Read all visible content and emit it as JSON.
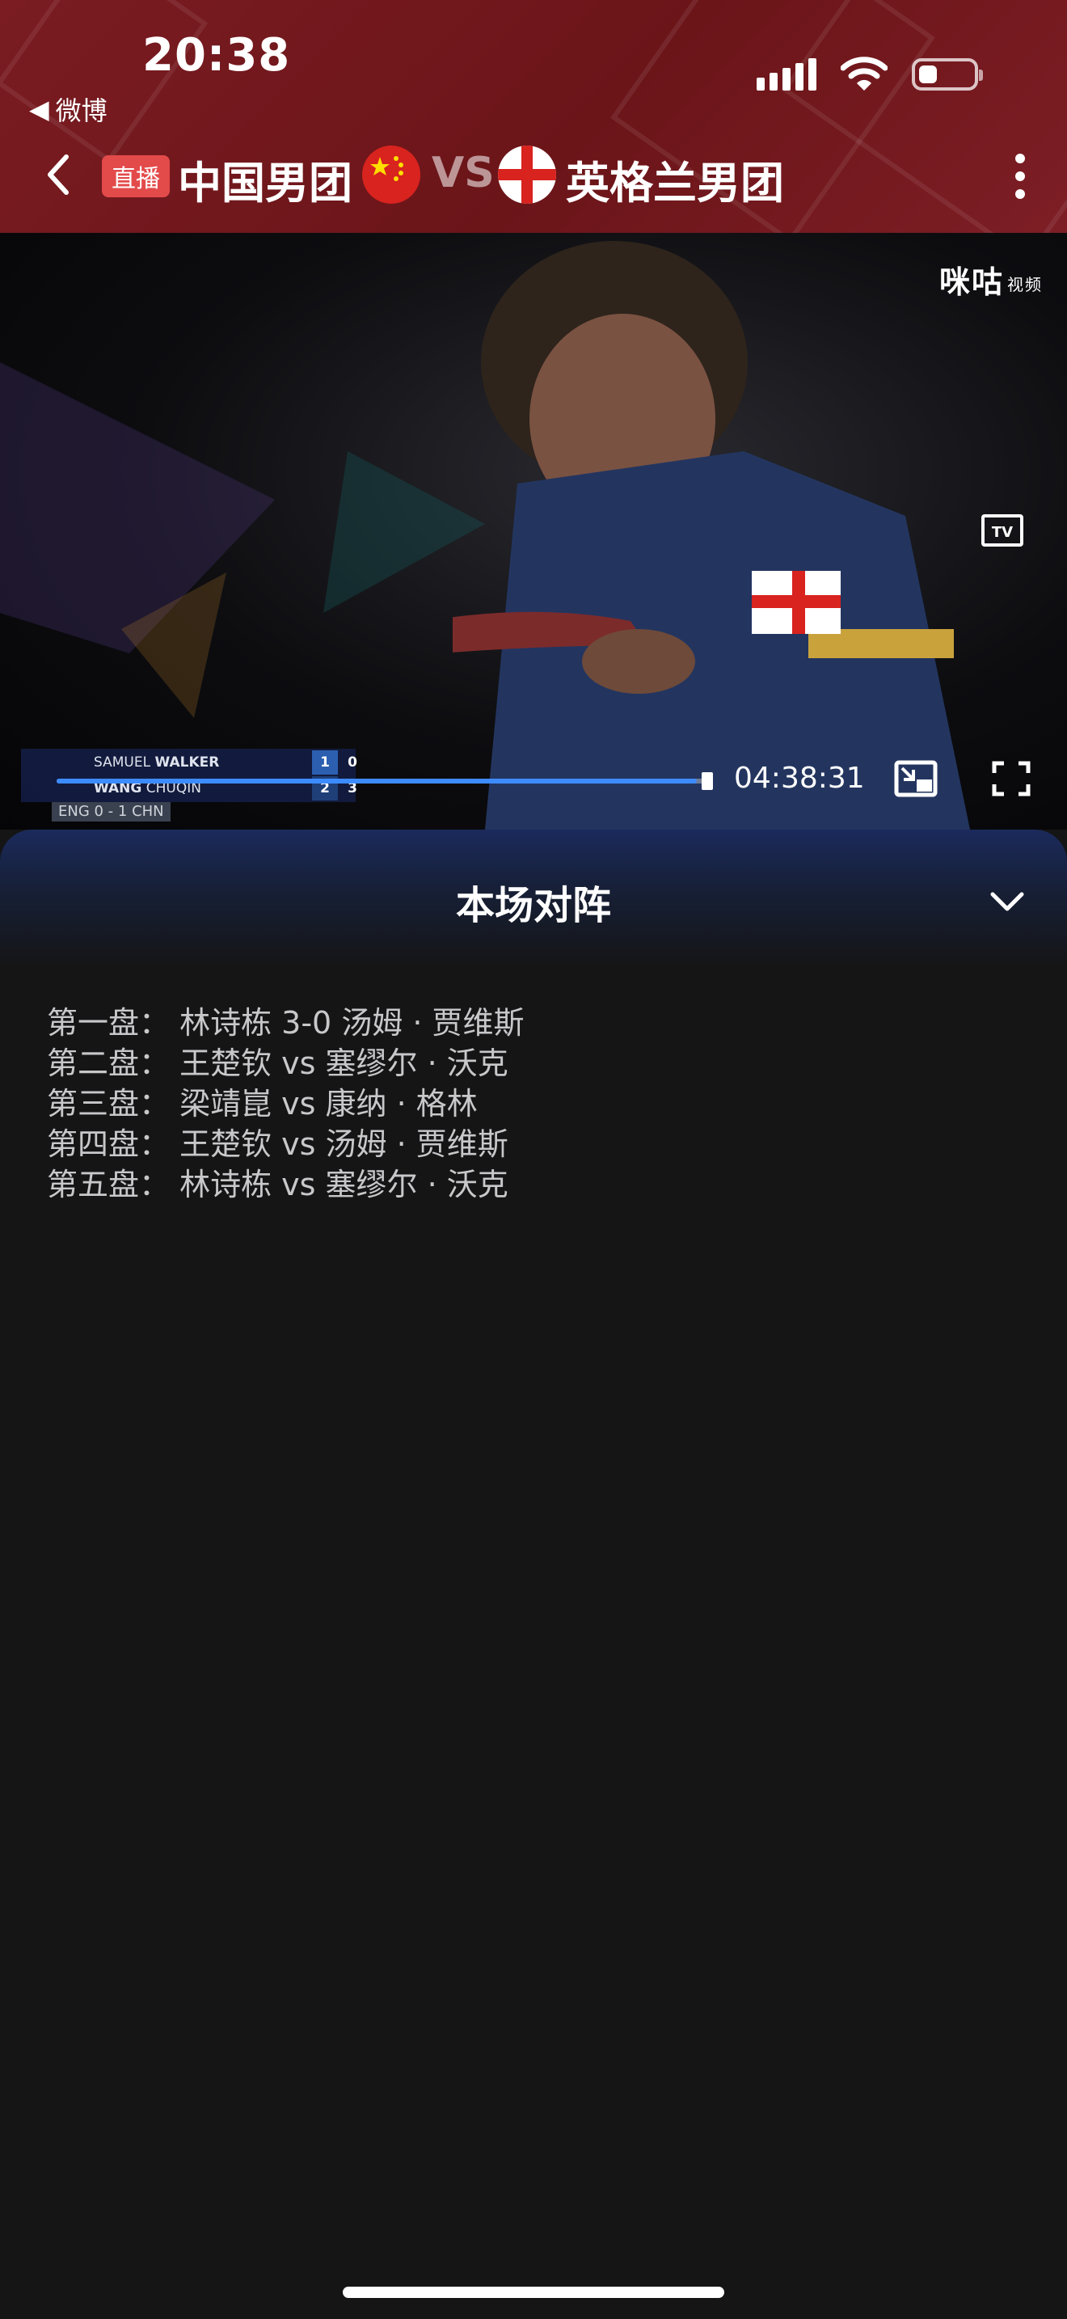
{
  "status_bar": {
    "time": "20:38",
    "back_app": "微博"
  },
  "nav": {
    "live_badge": "直播",
    "team_a": "中国男团",
    "vs": "VS",
    "team_b": "英格兰男团"
  },
  "video": {
    "brand": "咪咕",
    "brand_sub": "视频",
    "tv_label": "TV",
    "elapsed": "04:38:31",
    "progress": 0.98,
    "scoreboard": {
      "player_top_first": "SAMUEL",
      "player_top_last": "WALKER",
      "player_bottom_first": "WANG",
      "player_bottom_last": "CHUQIN",
      "top_games": "1",
      "top_points": "0",
      "bottom_games": "2",
      "bottom_points": "3",
      "team_score": "ENG 0 - 1 CHN"
    }
  },
  "lineup_panel": {
    "title": "本场对阵",
    "matches": [
      "第一盘： 林诗栋 3-0 汤姆 · 贾维斯",
      "第二盘： 王楚钦 vs 塞缪尔 · 沃克",
      "第三盘： 梁靖崑 vs 康纳 · 格林",
      "第四盘： 王楚钦 vs 汤姆 · 贾维斯",
      "第五盘： 林诗栋 vs 塞缪尔 · 沃克"
    ]
  },
  "colors": {
    "header_bg": "#6b1519",
    "live_badge": "#e34a4a",
    "progress": "#3d8cff",
    "panel_bg": "#151516"
  }
}
